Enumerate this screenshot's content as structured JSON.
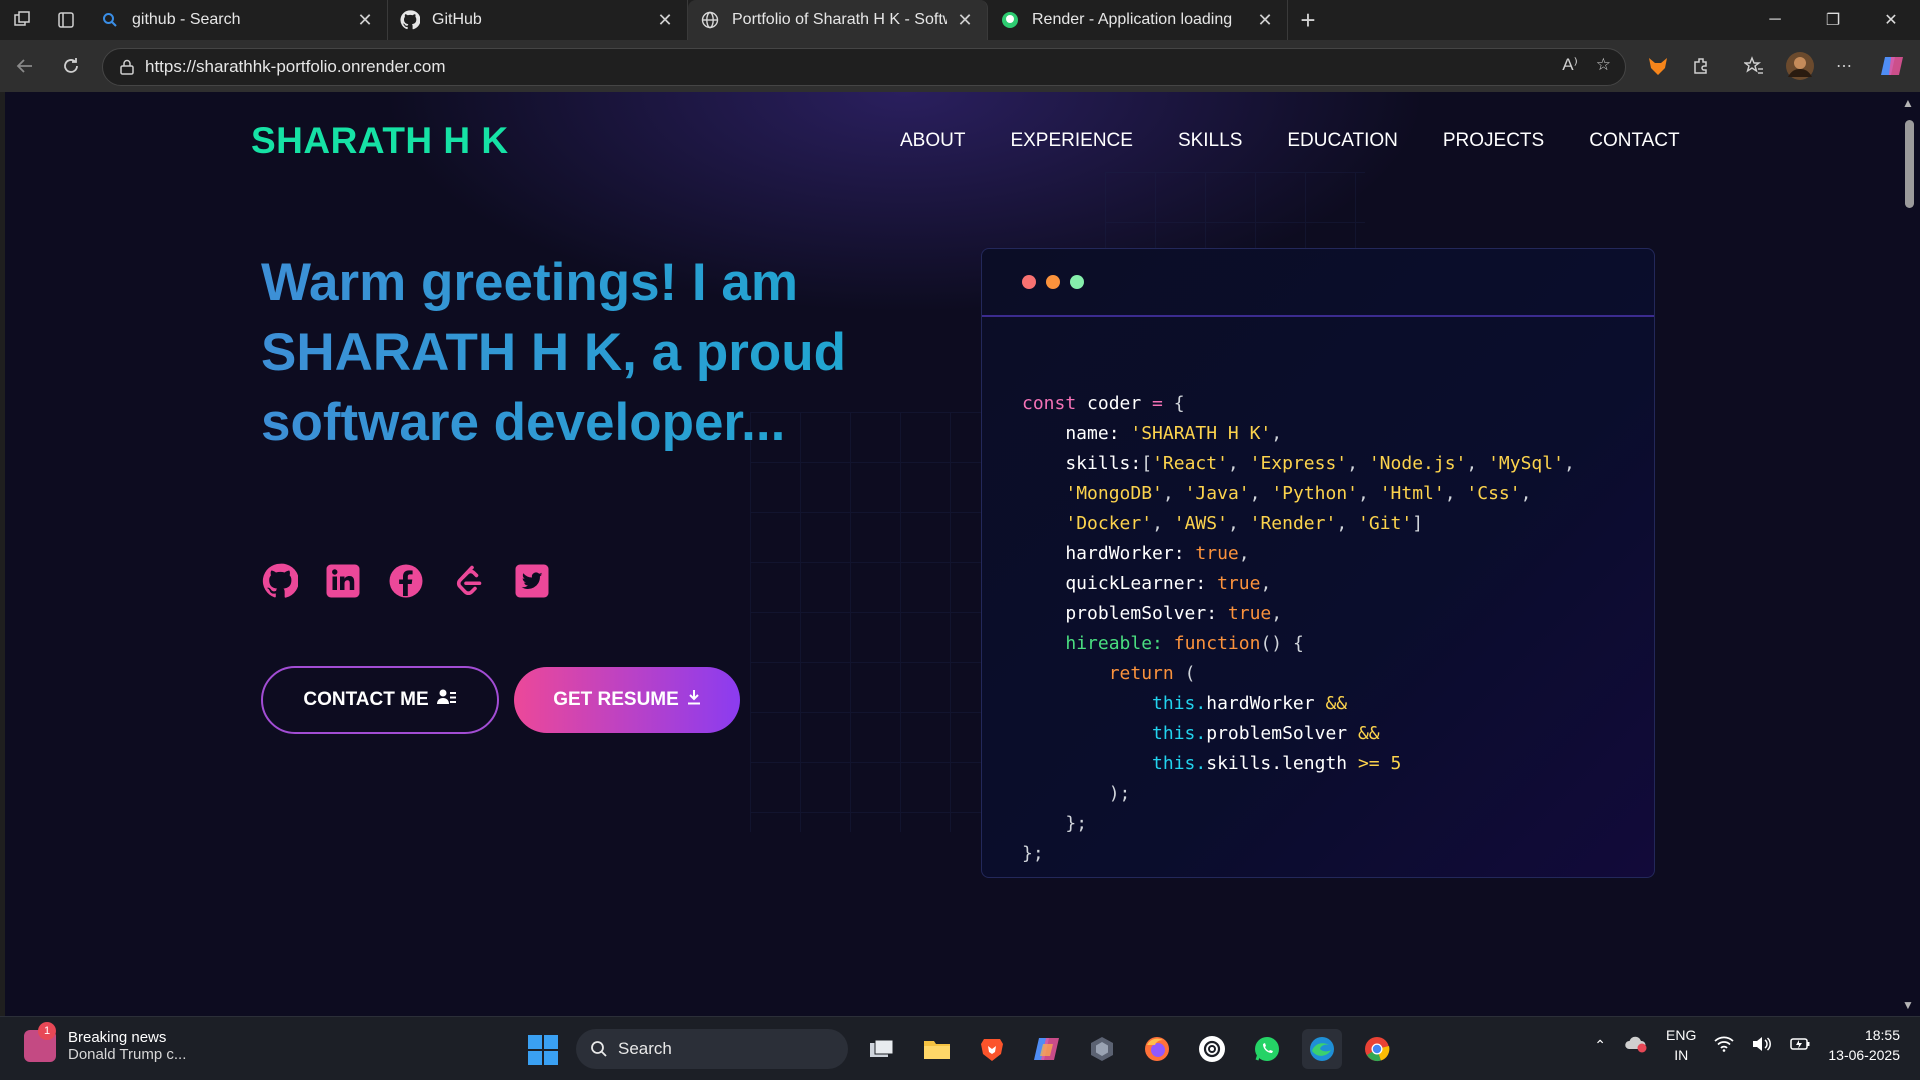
{
  "browser": {
    "tabs": [
      {
        "title": "github - Search",
        "icon": "search-icon",
        "active": false
      },
      {
        "title": "GitHub",
        "icon": "github-icon",
        "active": false
      },
      {
        "title": "Portfolio of Sharath H K - Softwar",
        "icon": "globe-icon",
        "active": true
      },
      {
        "title": "Render - Application loading",
        "icon": "render-icon",
        "active": false
      }
    ],
    "url": "https://sharathhk-portfolio.onrender.com"
  },
  "site": {
    "brand": "SHARATH H K",
    "nav": [
      "ABOUT",
      "EXPERIENCE",
      "SKILLS",
      "EDUCATION",
      "PROJECTS",
      "CONTACT"
    ],
    "hero_text": "Warm greetings! I am SHARATH H K, a proud software developer...",
    "socials": [
      "github-icon",
      "linkedin-icon",
      "facebook-icon",
      "leetcode-icon",
      "twitter-icon"
    ],
    "contact_label": "CONTACT ME",
    "resume_label": "GET RESUME",
    "accent_color": "#16e2a5",
    "social_color": "#ec4899"
  },
  "code": {
    "lines": [
      "const coder = {",
      "    name: 'SHARATH H K',",
      "    skills:['React', 'Express', 'Node.js', 'MySql',",
      "    'MongoDB', 'Java', 'Python', 'Html', 'Css',",
      "    'Docker', 'AWS', 'Render', 'Git']",
      "    hardWorker: true,",
      "    quickLearner: true,",
      "    problemSolver: true,",
      "    hireable: function() {",
      "        return (",
      "            this.hardWorker &&",
      "            this.problemSolver &&",
      "            this.skills.length >= 5",
      "        );",
      "    };",
      "};"
    ]
  },
  "taskbar": {
    "news_title": "Breaking news",
    "news_sub": "Donald Trump c...",
    "news_badge": "1",
    "search_placeholder": "Search",
    "lang_1": "ENG",
    "lang_2": "IN",
    "time": "18:55",
    "date": "13-06-2025"
  }
}
